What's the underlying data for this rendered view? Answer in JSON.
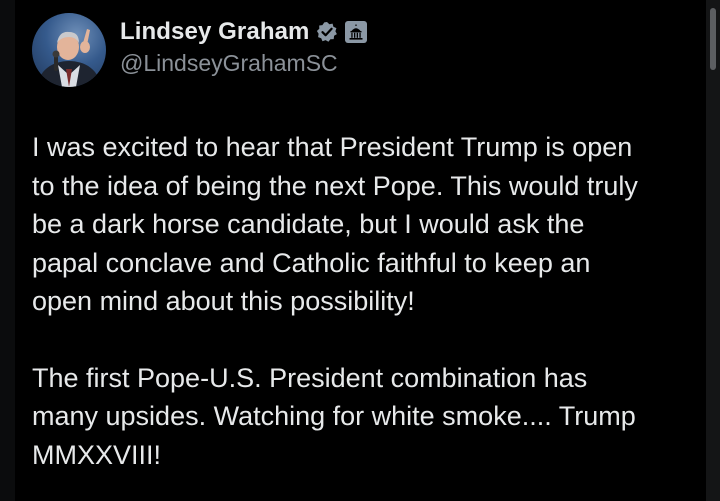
{
  "author": {
    "display_name": "Lindsey Graham",
    "handle": "@LindseyGrahamSC",
    "avatar_icon": "person-with-microphone-avatar",
    "verified_icon": "verified-badge-icon",
    "affiliation_icon": "government-capitol-badge-icon"
  },
  "tweet": {
    "paragraphs": [
      "I was excited to hear that President Trump is open\nto the idea of being the next Pope. This would truly\nbe a dark horse candidate, but I would ask the\npapal conclave and Catholic faithful to keep an\nopen mind about this possibility!",
      "The first Pope-U.S. President combination has\nmany upsides. Watching for white smoke.... Trump\nMMXXVIII!"
    ]
  },
  "colors": {
    "background": "#000000",
    "text_primary": "#e7e9ea",
    "text_secondary": "#8b9198",
    "badge_gray": "#8b98a5"
  }
}
